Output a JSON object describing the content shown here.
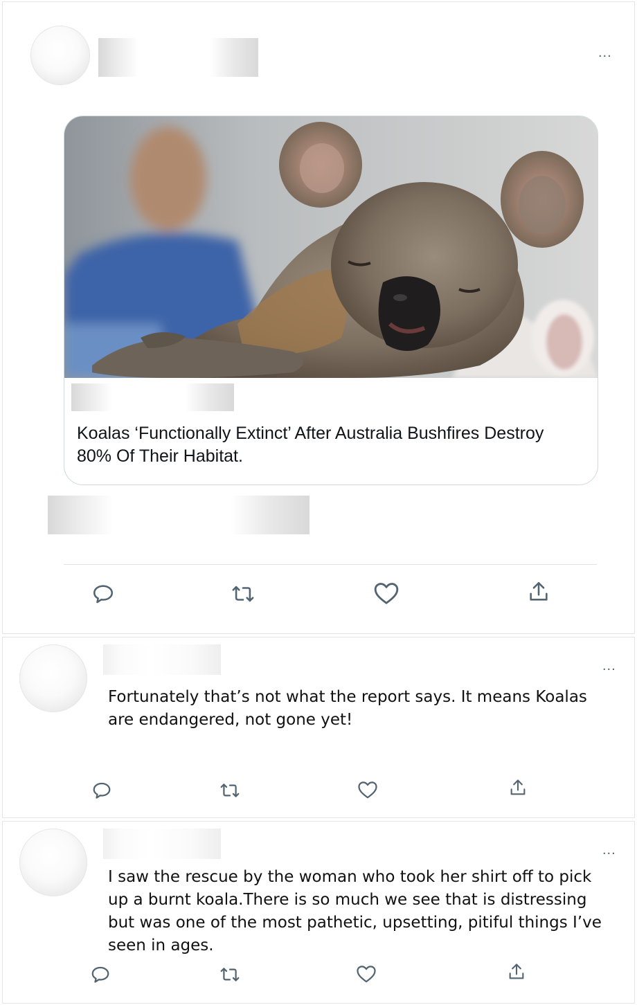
{
  "post": {
    "more_label": "...",
    "card": {
      "headline": "Koalas ‘Functionally Extinct’ After Australia Bushfires Destroy 80% Of Their Habitat."
    },
    "actions": {
      "reply_icon": "reply-icon",
      "retweet_icon": "retweet-icon",
      "like_icon": "heart-icon",
      "share_icon": "share-icon"
    }
  },
  "replies": [
    {
      "more_label": "...",
      "text_lines": [
        "Fortunately that’s not what the report says. It means Koalas",
        "are endangered, not gone yet!"
      ]
    },
    {
      "more_label": "...",
      "text_lines": [
        "I saw the rescue by the woman who took her shirt off to pick",
        "up a burnt koala.There is so much we see that is distressing",
        "but was one of the most pathetic, upsetting, pitiful things I’ve",
        "seen in ages."
      ]
    }
  ],
  "colors": {
    "icon": "#536471",
    "divider": "#dfe3e6",
    "card_border": "#cfd9de"
  }
}
